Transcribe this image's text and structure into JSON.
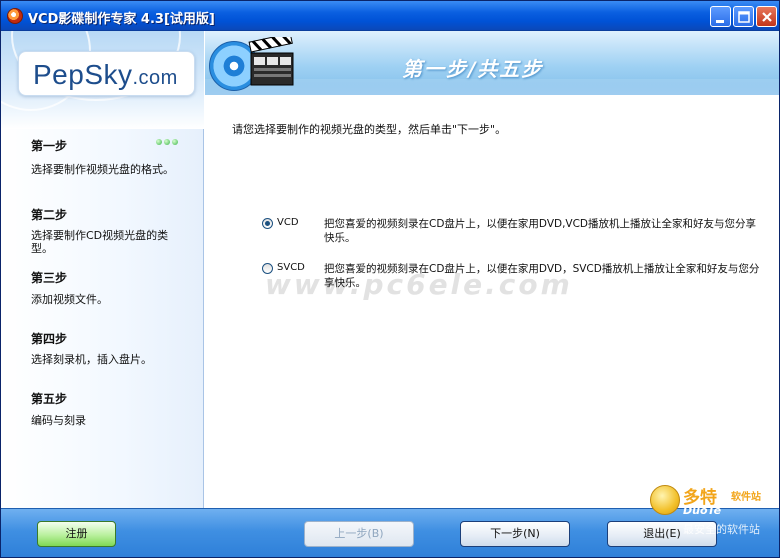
{
  "window": {
    "title": "VCD影碟制作专家 4.3[试用版]"
  },
  "logo": {
    "main": "PepSky",
    "suffix": ".com"
  },
  "banner": {
    "title": "第一步/共五步"
  },
  "sidebar": {
    "steps": [
      {
        "title": "第一步",
        "desc": "选择要制作视频光盘的格式。",
        "active": true
      },
      {
        "title": "第二步",
        "desc": "选择要制作CD视频光盘的类型。"
      },
      {
        "title": "第三步",
        "desc": "添加视频文件。"
      },
      {
        "title": "第四步",
        "desc": "选择刻录机，插入盘片。"
      },
      {
        "title": "第五步",
        "desc": "编码与刻录"
      }
    ]
  },
  "main": {
    "instruction": "请您选择要制作的视频光盘的类型，然后单击\"下一步\"。",
    "options": [
      {
        "label": "VCD",
        "desc": "把您喜爱的视频刻录在CD盘片上，以便在家用DVD,VCD播放机上播放让全家和好友与您分享快乐。",
        "selected": true
      },
      {
        "label": "SVCD",
        "desc": "把您喜爱的视频刻录在CD盘片上，以便在家用DVD，SVCD播放机上播放让全家和好友与您分享快乐。",
        "selected": false
      }
    ],
    "watermark": "www.pc6ele.com"
  },
  "footer": {
    "register": "注册",
    "prev": "上一步(B)",
    "next": "下一步(N)",
    "exit": "退出(E)"
  },
  "brand_watermark": {
    "name": "多特",
    "sub": "软件站",
    "latin": "DuoTe",
    "slogan": "最安全的软件站"
  },
  "colors": {
    "titlebar": "#0052d6",
    "footer": "#3f8fe2",
    "accent_green": "#3cb34a"
  }
}
